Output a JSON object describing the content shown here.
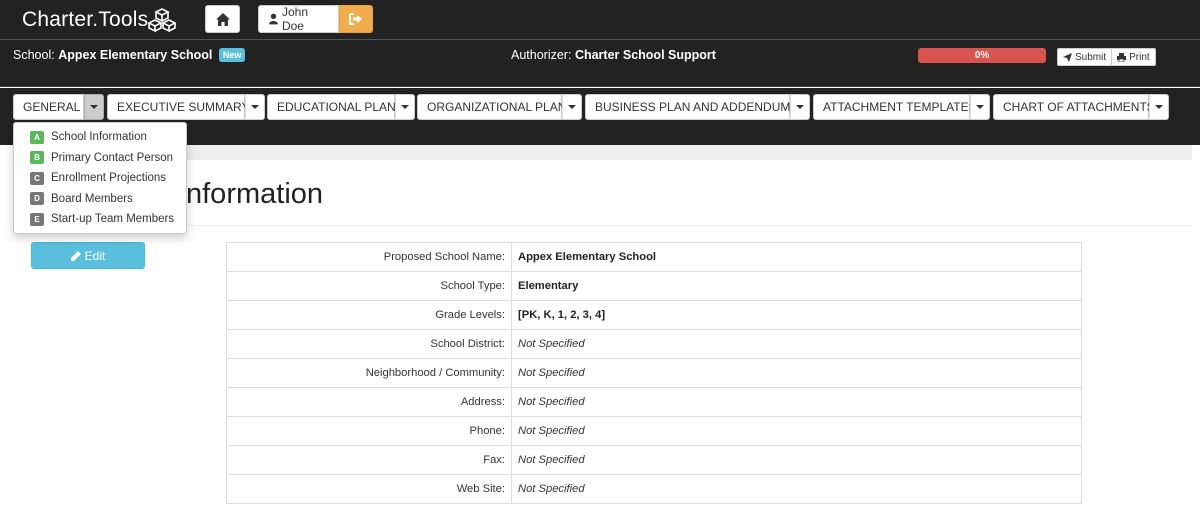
{
  "header": {
    "brand": "Charter.Tools",
    "user_name": "John Doe"
  },
  "schoolbar": {
    "school_prefix": "School:",
    "school_name": "Appex Elementary School",
    "badge": "New",
    "authorizer_prefix": "Authorizer:",
    "authorizer_name": "Charter School Support",
    "progress": "0%",
    "progress_value": 0,
    "submit_label": "Submit",
    "print_label": "Print"
  },
  "nav": {
    "items": [
      {
        "label": "GENERAL"
      },
      {
        "label": "EXECUTIVE SUMMARY"
      },
      {
        "label": "EDUCATIONAL PLAN"
      },
      {
        "label": "ORGANIZATIONAL PLAN"
      },
      {
        "label": "BUSINESS PLAN AND ADDENDUMS"
      },
      {
        "label": "ATTACHMENT TEMPLATES"
      },
      {
        "label": "CHART OF ATTACHMENTS"
      }
    ]
  },
  "dropdown": {
    "items": [
      {
        "letter": "A",
        "label": "School Information",
        "color": "#5cb85c"
      },
      {
        "letter": "B",
        "label": "Primary Contact Person",
        "color": "#5cb85c"
      },
      {
        "letter": "C",
        "label": "Enrollment Projections",
        "color": "#777777"
      },
      {
        "letter": "D",
        "label": "Board Members",
        "color": "#777777"
      },
      {
        "letter": "E",
        "label": "Start-up Team Members",
        "color": "#777777"
      }
    ]
  },
  "main": {
    "title": "nformation",
    "edit_label": "Edit",
    "rows": [
      {
        "label": "Proposed School Name:",
        "value": "Appex Elementary School"
      },
      {
        "label": "School Type:",
        "value": "Elementary"
      },
      {
        "label": "Grade Levels:",
        "value": "[PK, K, 1, 2, 3, 4]"
      },
      {
        "label": "School District:",
        "value": "Not Specified"
      },
      {
        "label": "Neighborhood / Community:",
        "value": "Not Specified"
      },
      {
        "label": "Address:",
        "value": "Not Specified"
      },
      {
        "label": "Phone:",
        "value": "Not Specified"
      },
      {
        "label": "Fax:",
        "value": "Not Specified"
      },
      {
        "label": "Web Site:",
        "value": "Not Specified"
      }
    ]
  },
  "colors": {
    "topbar": "#222222",
    "progress": "#d9534f",
    "logout": "#f0ad4e",
    "edit": "#5bc0de",
    "badge": "#5bc0de",
    "done": "#5cb85c",
    "pending": "#777777"
  }
}
